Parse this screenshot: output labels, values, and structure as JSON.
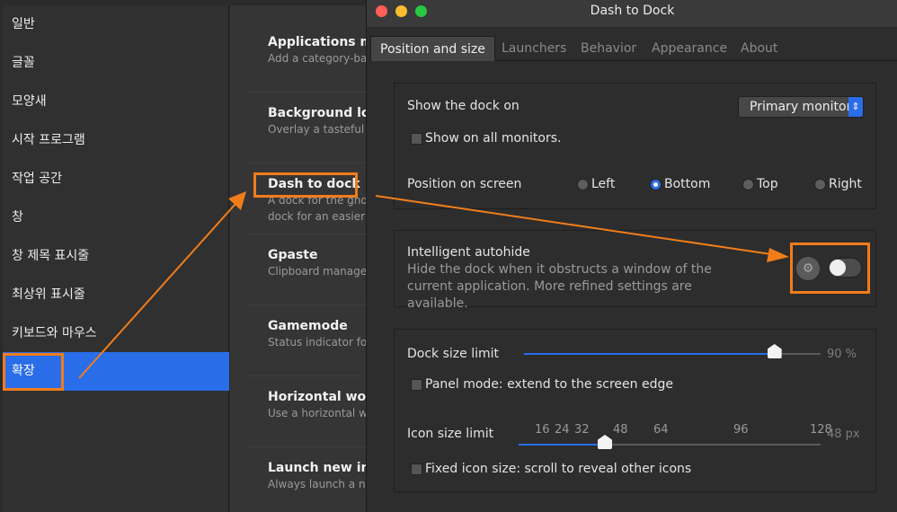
{
  "sidebar": {
    "items": [
      {
        "label": "일반"
      },
      {
        "label": "글꼴"
      },
      {
        "label": "모양새"
      },
      {
        "label": "시작 프로그램"
      },
      {
        "label": "작업 공간"
      },
      {
        "label": "창"
      },
      {
        "label": "창 제목 표시줄"
      },
      {
        "label": "최상위 표시줄"
      },
      {
        "label": "키보드와 마우스"
      },
      {
        "label": "확장"
      }
    ]
  },
  "extensions": [
    {
      "title": "Applications me",
      "desc": "Add a category-base"
    },
    {
      "title": "Background log",
      "desc": "Overlay a tasteful lo"
    },
    {
      "title": "Dash to dock",
      "desc": "A dock for the gnom",
      "desc2": "dock for an easier la"
    },
    {
      "title": "Gpaste",
      "desc": "Clipboard managem"
    },
    {
      "title": "Gamemode",
      "desc": "Status indicator for"
    },
    {
      "title": "Horizontal work",
      "desc": "Use a horizontal wo"
    },
    {
      "title": "Launch new inst",
      "desc": "Always launch a nev"
    }
  ],
  "dialog": {
    "title": "Dash to Dock",
    "tabs": [
      "Position and size",
      "Launchers",
      "Behavior",
      "Appearance",
      "About"
    ],
    "show_dock_on_label": "Show the dock on",
    "monitor_value": "Primary monitor",
    "all_monitors_label": "Show on all monitors.",
    "position_label": "Position on screen",
    "positions": [
      "Left",
      "Bottom",
      "Top",
      "Right"
    ],
    "autohide_label": "Intelligent autohide",
    "autohide_desc": "Hide the dock when it obstructs a window of the current application. More refined settings are available.",
    "dock_size_label": "Dock size limit",
    "dock_size_value": "90 %",
    "panel_mode_label": "Panel mode: extend to the screen edge",
    "icon_size_label": "Icon size limit",
    "icon_ticks": [
      "16",
      "24",
      "32",
      "48",
      "64",
      "96",
      "128"
    ],
    "icon_size_value": "48 px",
    "fixed_icon_label": "Fixed icon size: scroll to reveal other icons"
  },
  "state": {
    "selected_position": "Bottom",
    "dock_size_fraction": 0.9,
    "icon_size": 48,
    "autohide_enabled": false
  },
  "colors": {
    "accent": "#2a6de8",
    "highlight": "#f07d1a",
    "close": "#ff5f57",
    "minimize": "#febc2e",
    "maximize": "#28c840"
  }
}
